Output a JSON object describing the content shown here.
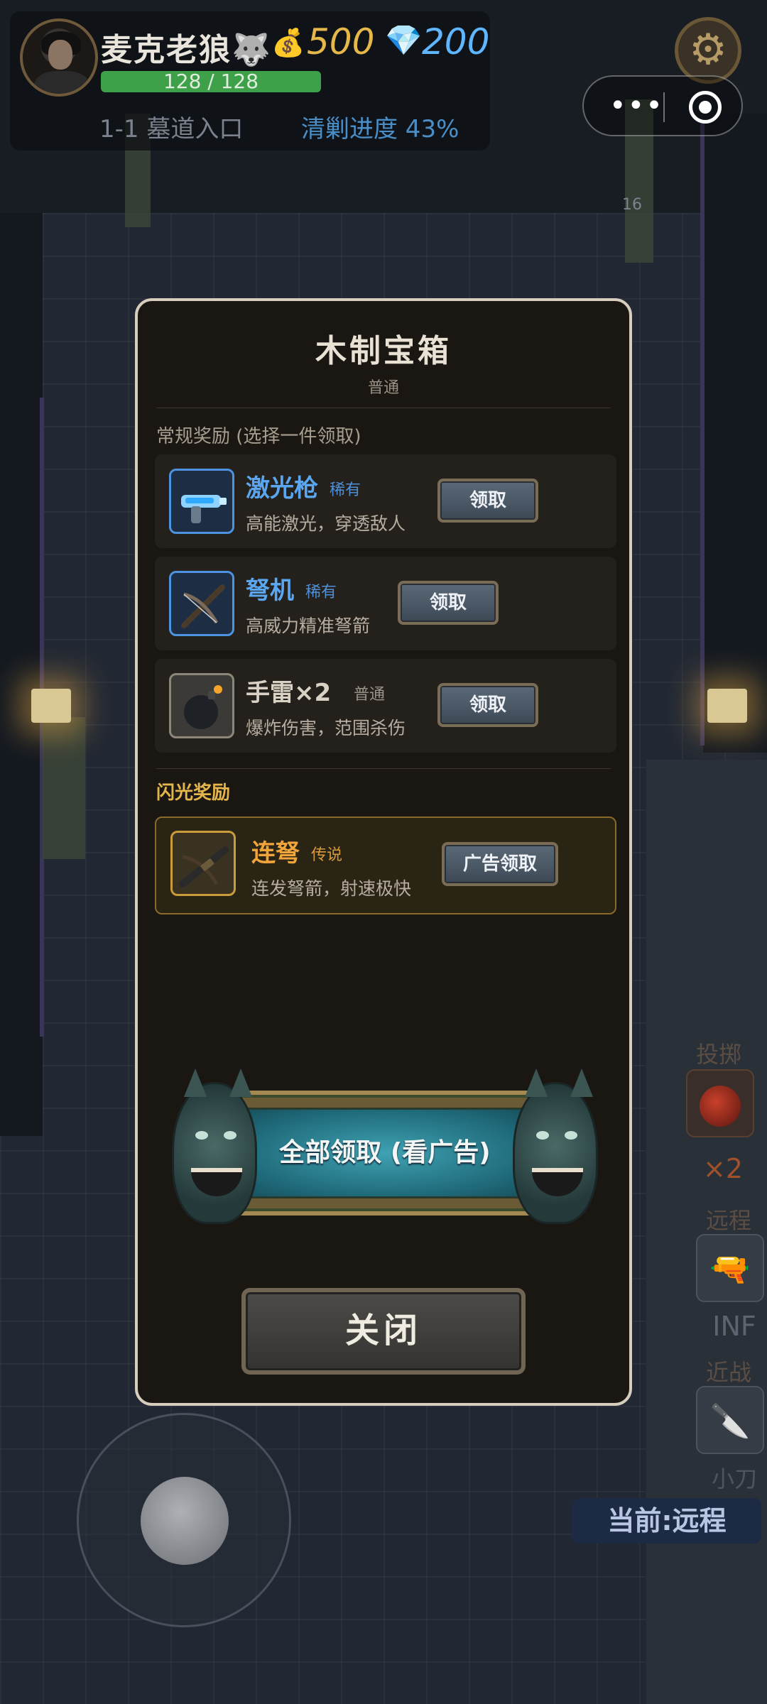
{
  "hud": {
    "player_name": "麦克老狼🐺",
    "coin_icon": "💰",
    "coins": "500",
    "gem_icon": "💎",
    "gems": "200",
    "hp_text": "128 / 128",
    "hp_fraction": 1.0,
    "stage": "1-1 墓道入口",
    "clear_progress": "清剿进度 43%"
  },
  "scene": {
    "marker": "16"
  },
  "capsule": {
    "more_glyph": "•••"
  },
  "sidebar": {
    "throw_label": "投掷",
    "throw_count": "×2",
    "ranged_label": "远程",
    "ranged_ammo": "INF",
    "melee_label": "近战",
    "melee_name": "小刀",
    "current_mode": "当前:远程"
  },
  "modal": {
    "title": "木制宝箱",
    "subtitle": "普通",
    "normal_section": "常规奖励 (选择一件领取)",
    "flash_section": "闪光奖励",
    "normal_rewards": [
      {
        "name": "激光枪",
        "rarity": "稀有",
        "desc": "高能激光，穿透敌人",
        "button": "领取",
        "icon": "laser-gun-icon"
      },
      {
        "name": "弩机",
        "rarity": "稀有",
        "desc": "高威力精准弩箭",
        "button": "领取",
        "icon": "crossbow-icon"
      },
      {
        "name": "手雷×2",
        "rarity": "普通",
        "desc": "爆炸伤害，范围杀伤",
        "button": "领取",
        "icon": "grenade-icon"
      }
    ],
    "flash_reward": {
      "name": "连弩",
      "rarity": "传说",
      "desc": "连发弩箭，射速极快",
      "button": "广告领取",
      "icon": "repeating-crossbow-icon"
    },
    "claim_all": "全部领取 (看广告)",
    "close": "关闭"
  },
  "colors": {
    "rare": "#5aa6f0",
    "common": "#d8d1c4",
    "legend": "#f0a43a",
    "coin": "#e6b84a",
    "gem": "#5fb6ff",
    "hp": "#3fa04a"
  }
}
